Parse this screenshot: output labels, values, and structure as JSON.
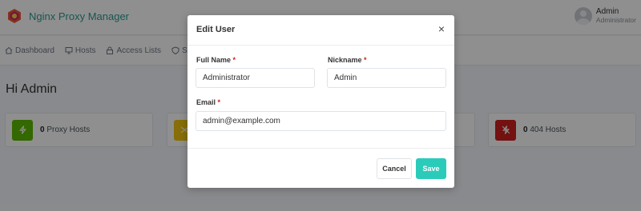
{
  "app": {
    "brand_name": "Nginx Proxy Manager",
    "user_name": "Admin",
    "user_role": "Administrator"
  },
  "nav": {
    "items": [
      {
        "label": "Dashboard",
        "icon": "home-icon"
      },
      {
        "label": "Hosts",
        "icon": "monitor-icon"
      },
      {
        "label": "Access Lists",
        "icon": "lock-icon"
      },
      {
        "label": "SS",
        "icon": "shield-icon"
      }
    ]
  },
  "page": {
    "title": "Hi Admin"
  },
  "stats": [
    {
      "count": "0",
      "label": "Proxy Hosts",
      "color": "#5eba00",
      "icon": "zap-icon"
    },
    {
      "count": "",
      "label": "",
      "color": "#f1c40f",
      "icon": "shuffle-icon"
    },
    {
      "count": "",
      "label": "",
      "color": "#467fcf",
      "icon": "radio-icon"
    },
    {
      "count": "0",
      "label": "404 Hosts",
      "color": "#cd201f",
      "icon": "zap-off-icon"
    }
  ],
  "modal": {
    "title": "Edit User",
    "full_name_label": "Full Name",
    "full_name_value": "Administrator",
    "nickname_label": "Nickname",
    "nickname_value": "Admin",
    "email_label": "Email",
    "email_value": "admin@example.com",
    "required_mark": "*",
    "cancel_label": "Cancel",
    "save_label": "Save",
    "close_glyph": "×"
  }
}
